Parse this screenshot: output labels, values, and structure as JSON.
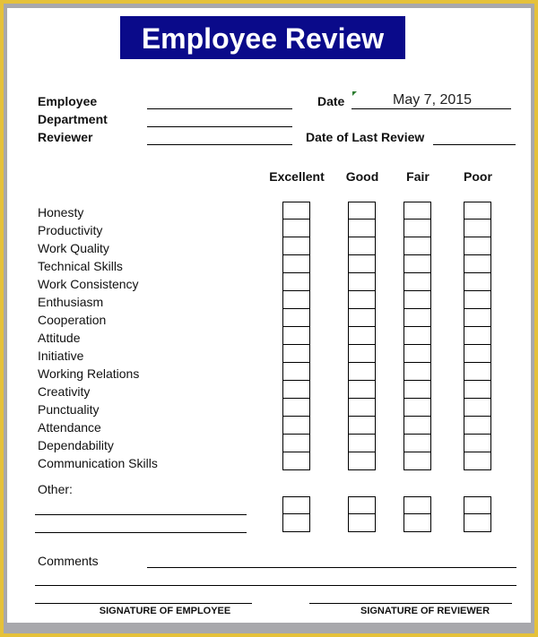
{
  "title": "Employee Review",
  "header_fields": {
    "employee_label": "Employee",
    "department_label": "Department",
    "reviewer_label": "Reviewer",
    "date_label": "Date",
    "date_value": "May 7, 2015",
    "last_review_label": "Date of Last Review",
    "last_review_value": ""
  },
  "rating_columns": [
    "Excellent",
    "Good",
    "Fair",
    "Poor"
  ],
  "criteria": [
    "Honesty",
    "Productivity",
    "Work Quality",
    "Technical Skills",
    "Work Consistency",
    "Enthusiasm",
    "Cooperation",
    "Attitude",
    "Initiative",
    "Working Relations",
    "Creativity",
    "Punctuality",
    "Attendance",
    "Dependability",
    "Communication Skills"
  ],
  "other_label": "Other:",
  "other_rows": 2,
  "comments_label": "Comments",
  "signatures": {
    "employee": "SIGNATURE OF EMPLOYEE",
    "reviewer": "SIGNATURE OF REVIEWER"
  },
  "colors": {
    "banner": "#0a0a8a",
    "outer_border": "#e5c13a",
    "inner_border": "#a8a8ac"
  }
}
